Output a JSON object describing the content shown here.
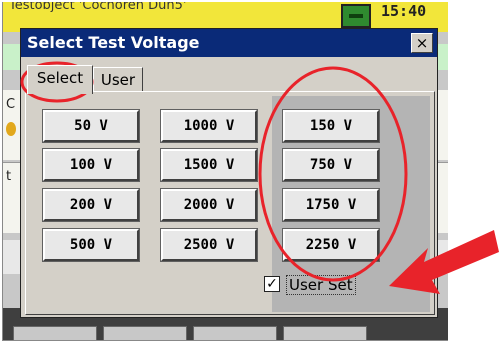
{
  "device": {
    "title": "Testobject 'Cochoren Dun5'",
    "time": "15:40",
    "side_label_top": "C",
    "side_label_bottom": "t"
  },
  "dialog": {
    "title": "Select Test Voltage",
    "close_glyph": "×",
    "tabs": [
      {
        "label": "Select",
        "active": true
      },
      {
        "label": "User",
        "active": false
      }
    ],
    "buttons_col1": [
      "50 V",
      "100 V",
      "200 V",
      "500 V"
    ],
    "buttons_col2": [
      "1000 V",
      "1500 V",
      "2000 V",
      "2500 V"
    ],
    "buttons_user": [
      "150 V",
      "750 V",
      "1750 V",
      "2250 V"
    ],
    "user_set": {
      "label": "User Set",
      "checked": true,
      "check_glyph": "✓"
    }
  },
  "annotations": {
    "color": "#e8232a",
    "arrow_color": "#e8232a"
  }
}
